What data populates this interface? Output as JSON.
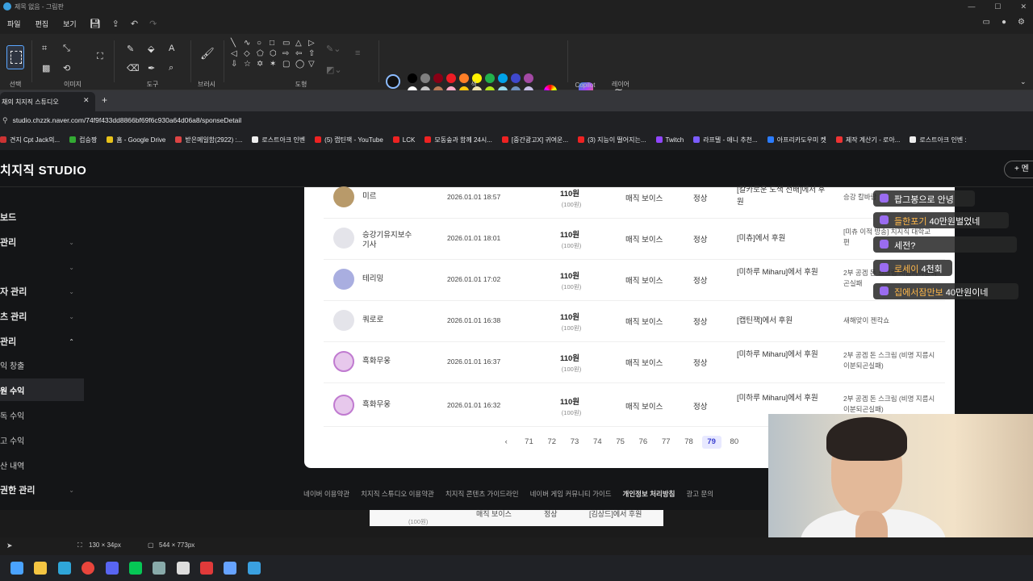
{
  "paint": {
    "title": "제목 없음 - 그림판",
    "menu": [
      "파일",
      "편집",
      "보기"
    ],
    "groups": [
      "선택",
      "이미지",
      "도구",
      "브러시",
      "도형",
      "색",
      "Copilot",
      "레이어"
    ],
    "shape_glyphs": [
      "╲",
      "∿",
      "○",
      "□",
      "▭",
      "△",
      "▷",
      "◁",
      "◇",
      "⬠",
      "⬡",
      "⇨",
      "⇦",
      "⇧",
      "⇩",
      "☆",
      "✡",
      "✶",
      "▢",
      "◯",
      "▽"
    ],
    "status_selection": "130 × 34px",
    "status_canvas": "544 × 773px"
  },
  "palette": {
    "colors": [
      "#000000",
      "#7f7f7f",
      "#880015",
      "#ed1c24",
      "#ff7f27",
      "#fff200",
      "#22b14c",
      "#00a2e8",
      "#3f48cc",
      "#a349a4",
      "#ffffff",
      "#c3c3c3",
      "#b97a57",
      "#ffaec9",
      "#ffc90e",
      "#efe4b0",
      "#b5e61d",
      "#99d9ea",
      "#7092be",
      "#c8bfe7"
    ]
  },
  "browser": {
    "tab_title": "채의 치지직 스튜디오",
    "url": "studio.chzzk.naver.com/74f9f433dd8866bf69f6c930a64d06a8/sponseDetail",
    "bookmarks": [
      "견지 Cpt Jack의...",
      "컵승짱",
      "홈 - Google Drive",
      "받은메일함(2922) :...",
      "로스트아크 인벤",
      "(5) 캡틴잭 - YouTube",
      "LCK",
      "모동숲과 함께 24시...",
      "[중간광고X] 귀여운...",
      "(3) 지능이 떨어지는...",
      "Twitch",
      "라프텔 - 애니 추천...",
      "아프리카도우미 켓",
      "제작 계산기 - 로아...",
      "로스트아크 인벤 :"
    ],
    "bookmark_colors": [
      "#c33",
      "#3a3",
      "#e8c21a",
      "#d44",
      "#eee",
      "#e22",
      "#e22",
      "#e22",
      "#e22",
      "#e22",
      "#9146ff",
      "#7b5cff",
      "#2b7cff",
      "#e33",
      "#eee"
    ]
  },
  "studio": {
    "brand": "치지직 STUDIO",
    "new_button": "+ 멘",
    "nav": [
      {
        "label": "보드",
        "chev": ""
      },
      {
        "label": "관리",
        "chev": "⌄"
      },
      {
        "label": "",
        "chev": "⌄"
      },
      {
        "label": "자 관리",
        "chev": "⌄"
      },
      {
        "label": "츠 관리",
        "chev": "⌄"
      },
      {
        "label": "관리",
        "chev": "⌃"
      }
    ],
    "subnav": [
      "익 창출",
      "원 수익",
      "독 수익",
      "고 수익",
      "산 내역"
    ],
    "nav_bottom": {
      "label": "권한 관리",
      "chev": "⌄"
    },
    "rows": [
      {
        "nick": "미르",
        "date": "2026.01.01 18:57",
        "amount": "110원",
        "amount_sub": "(100원)",
        "type": "매직 보이스",
        "status": "정상",
        "source": "[칼카로운 도색 선배]에서 후원",
        "message": "승강 칼바람"
      },
      {
        "nick": "승강기유지보수기사",
        "date": "2026.01.01 18:01",
        "amount": "110원",
        "amount_sub": "(100원)",
        "type": "매직 보이스",
        "status": "정상",
        "source": "[미츄]에서 후원",
        "message": "[미츄 이적 방송] 치지직 대학교 편"
      },
      {
        "nick": "테리밍",
        "date": "2026.01.01 17:02",
        "amount": "110원",
        "amount_sub": "(100원)",
        "type": "매직 보이스",
        "status": "정상",
        "source": "[미하루 Miharu]에서 후원",
        "message": "2부 공겜 돈 스크림 지름시이분되곤실패"
      },
      {
        "nick": "쿼로로",
        "date": "2026.01.01 16:38",
        "amount": "110원",
        "amount_sub": "(100원)",
        "type": "매직 보이스",
        "status": "정상",
        "source": "[캡틴잭]에서 후원",
        "message": "새해맞이 젠칵쇼"
      },
      {
        "nick": "흑화무웅",
        "date": "2026.01.01 16:37",
        "amount": "110원",
        "amount_sub": "(100원)",
        "type": "매직 보이스",
        "status": "정상",
        "source": "[미하루 Miharu]에서 후원",
        "message": "2부 공겜 돈 스크림 (비명 지름시이분되곤실패)"
      },
      {
        "nick": "흑화무웅",
        "date": "2026.01.01 16:32",
        "amount": "110원",
        "amount_sub": "(100원)",
        "type": "매직 보이스",
        "status": "정상",
        "source": "[미하루 Miharu]에서 후원",
        "message": "2부 공겜 돈 스크림 (비명 지름시이분되곤실패)"
      }
    ],
    "pager": {
      "prev": "‹",
      "pages": [
        "71",
        "72",
        "73",
        "74",
        "75",
        "76",
        "77",
        "78",
        "79",
        "80"
      ],
      "current": "79"
    },
    "footer": [
      "네이버 이용약관",
      "치지직 스튜디오 이용약관",
      "치지직 콘텐츠 가이드라인",
      "네이버 게임 커뮤니티 가이드",
      "개인정보 처리방침",
      "광고 문의"
    ],
    "ghost_row": {
      "amount_sub": "(100원)",
      "type": "매직 보이스",
      "status": "정상",
      "source": "[김상드]에서 후원"
    }
  },
  "chat": [
    {
      "name": "",
      "text": "팝그봉으로 안녕"
    },
    {
      "name": "들한포기",
      "text": "40만원벌었네"
    },
    {
      "name": "",
      "text": "세전?"
    },
    {
      "name": "로세이",
      "text": "4천회"
    },
    {
      "name": "집에서잠만보",
      "text": "40만원이네"
    }
  ],
  "taskbar": {
    "icons": [
      "windows-start-icon",
      "file-explorer-icon",
      "edge-icon",
      "chrome-icon",
      "discord-icon",
      "line-icon",
      "app-icon",
      "obs-icon",
      "s-app-icon",
      "notepad-icon",
      "paint-icon"
    ],
    "colors": [
      "#4aa3ff",
      "#f4c542",
      "#2fa6d9",
      "#e8453c",
      "#5865f2",
      "#06c755",
      "#8aa",
      "#ddd",
      "#e03a3a",
      "#66a3ff",
      "#3aa0e0"
    ]
  }
}
